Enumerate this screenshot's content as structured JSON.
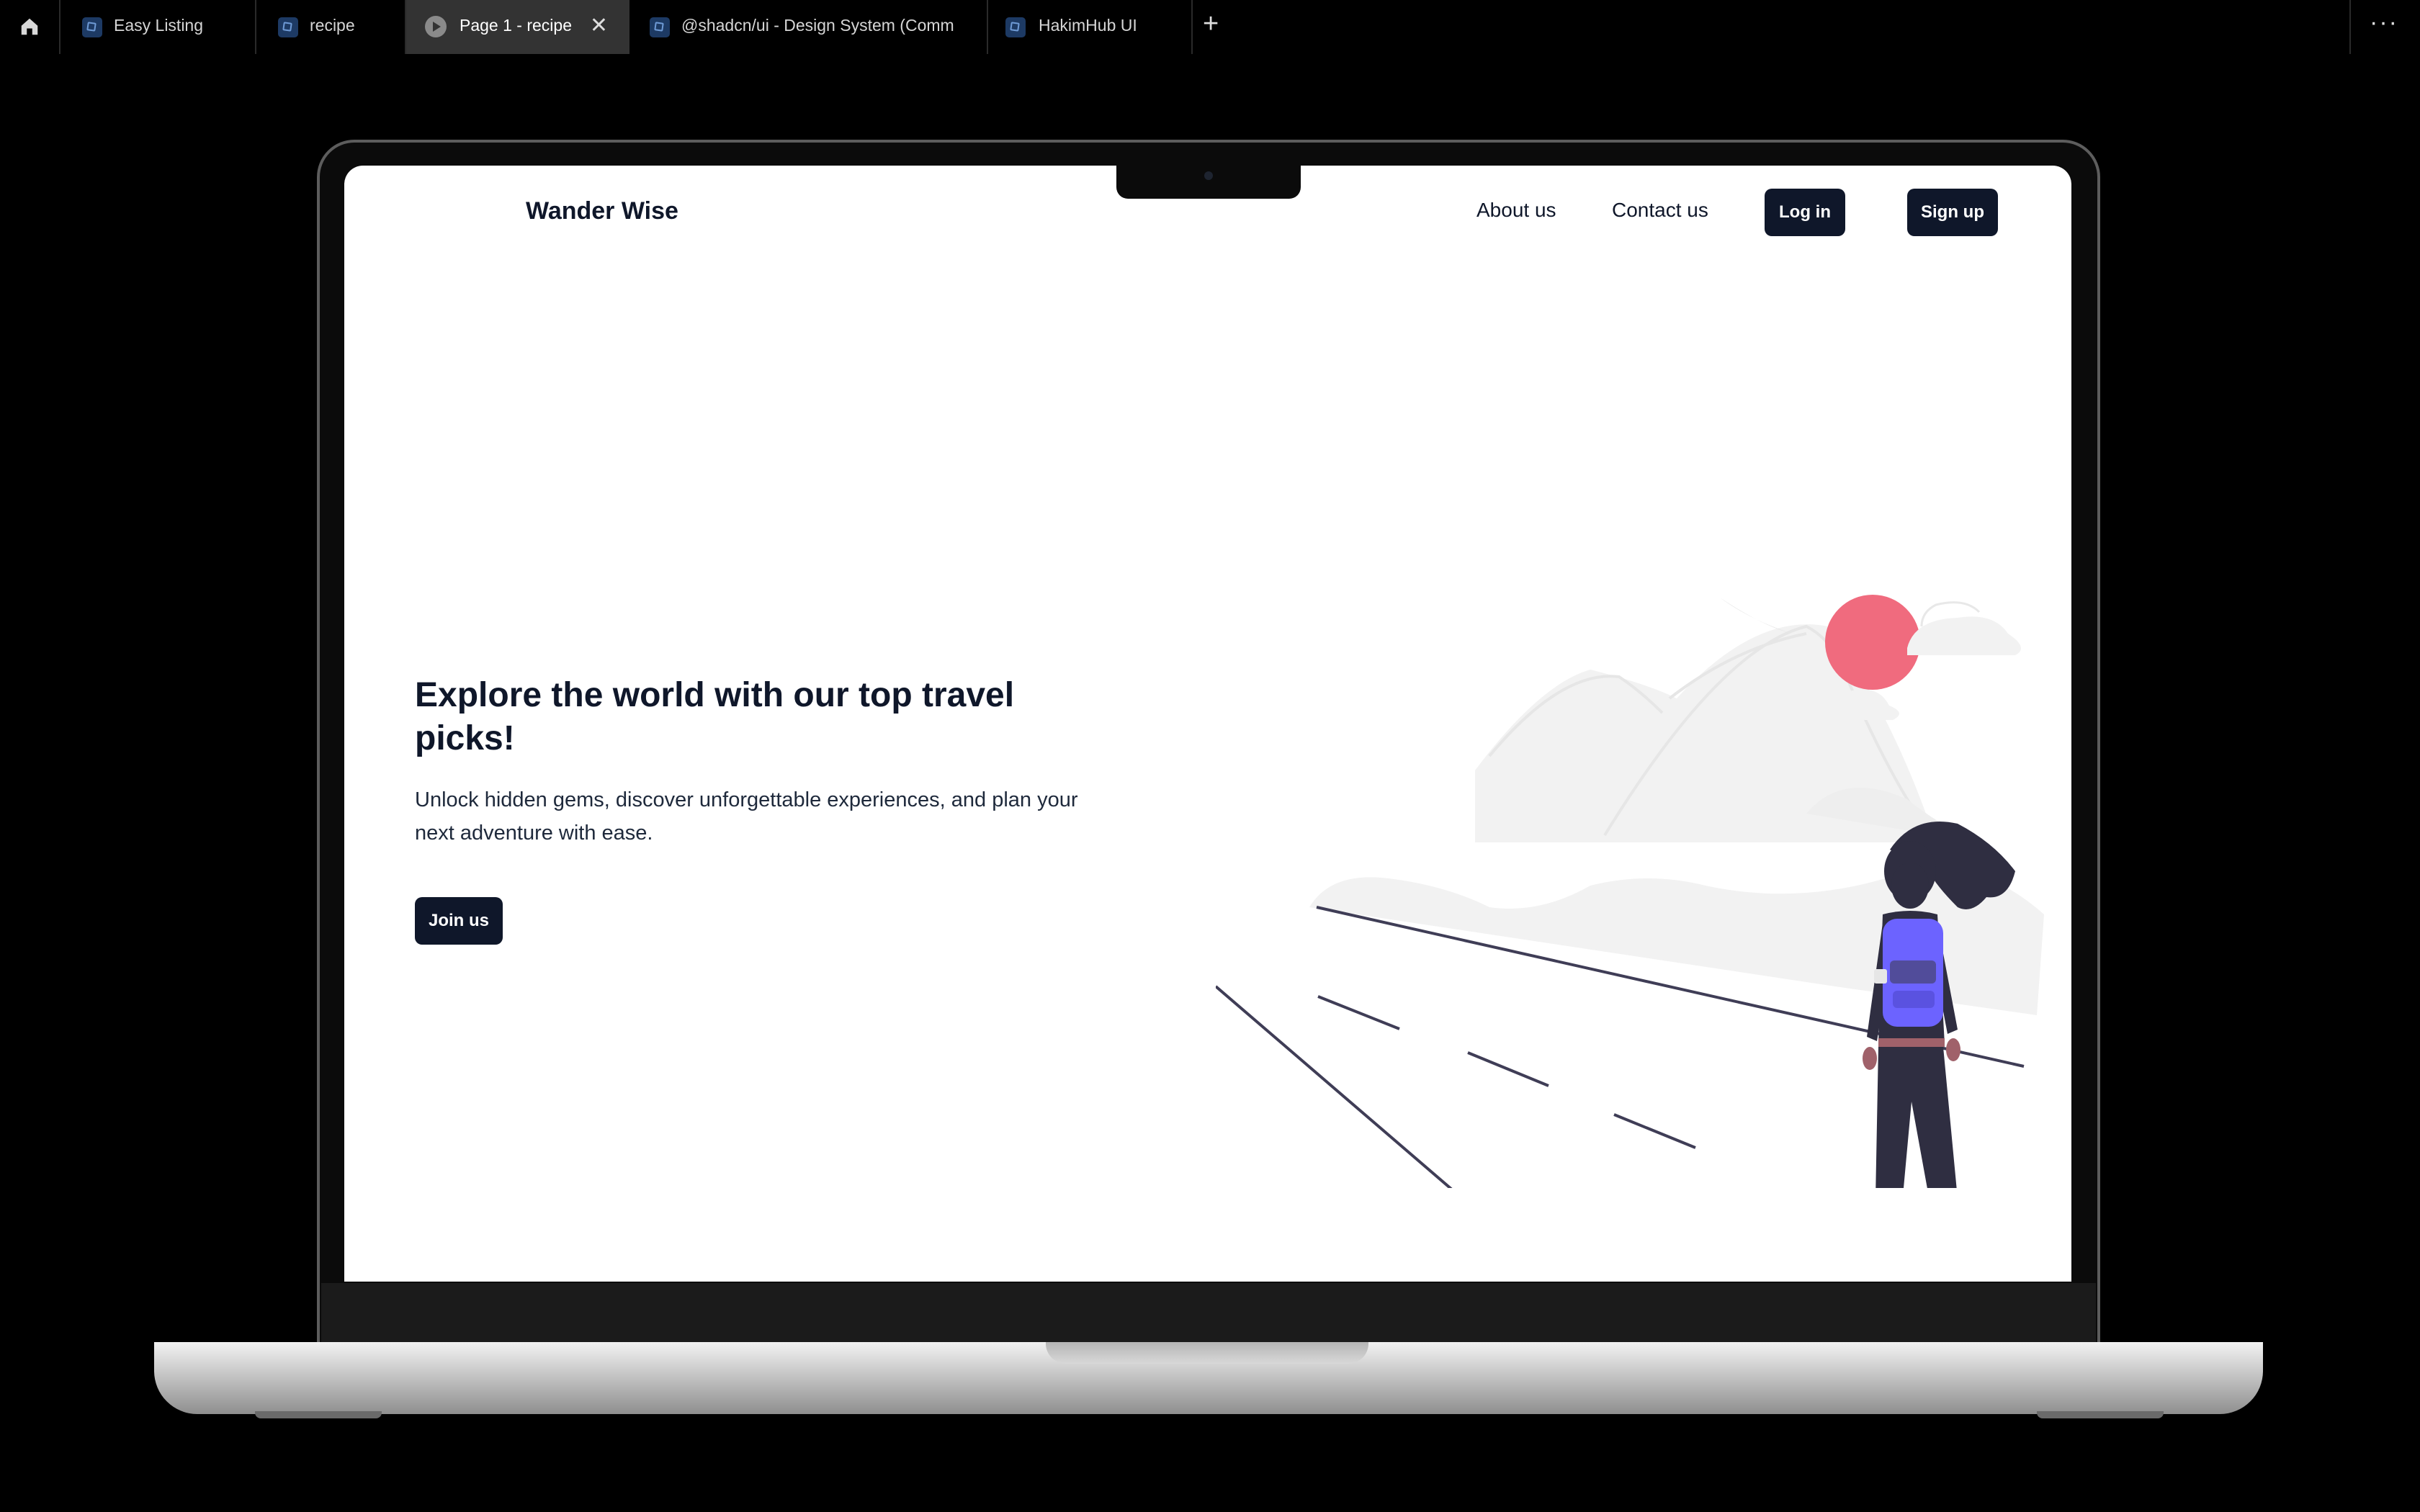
{
  "tabs": [
    {
      "label": "Easy Listing",
      "icon": "figma-file-icon"
    },
    {
      "label": "recipe",
      "icon": "figma-file-icon"
    },
    {
      "label": "Page 1 - recipe",
      "icon": "play-icon",
      "active": true
    },
    {
      "label": "@shadcn/ui - Design System (Comm",
      "icon": "figma-file-icon"
    },
    {
      "label": "HakimHub UI",
      "icon": "figma-file-icon"
    }
  ],
  "toolbar": {
    "new_tab": "+",
    "more": "···",
    "close": "✕"
  },
  "site": {
    "brand": "Wander Wise",
    "nav": {
      "about": "About us",
      "contact": "Contact us",
      "login": "Log in",
      "signup": "Sign up"
    },
    "hero": {
      "title": "Explore the world with our top travel picks!",
      "subtitle": "Unlock hidden gems, discover unforgettable experiences, and plan your next adventure with ease.",
      "cta": "Join us"
    }
  },
  "colors": {
    "primary": "#0f172a",
    "sun": "#f06b7e",
    "backpack": "#6c63ff",
    "person": "#2f2e41"
  }
}
